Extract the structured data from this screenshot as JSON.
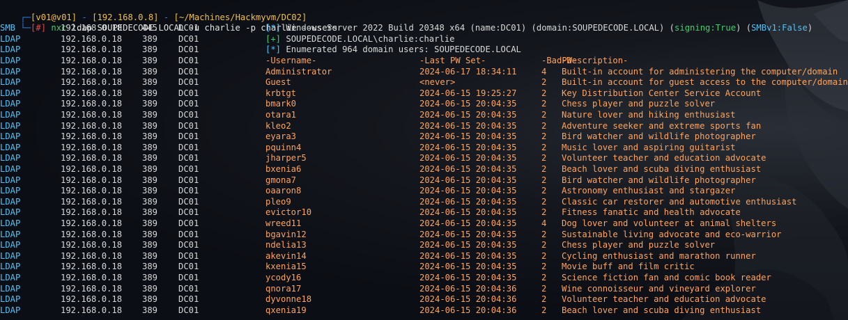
{
  "prompt": {
    "frame_top": "┌─",
    "user_host": "[v01@v01]",
    "sep1": " - ",
    "ip": "[192.168.0.8]",
    "sep2": " - ",
    "path": "[~/Machines/Hackmyvm/DC02]",
    "frame_bottom": "└─",
    "hash": "[#]",
    "command": "nxc",
    "args": " ldap SOUPEDECODE.LOCAL -u charlie -p charlie --users"
  },
  "info_lines": [
    {
      "proto": "SMB",
      "ip": "192.168.0.18",
      "port": "445",
      "host": "DC01",
      "tag": "[*]",
      "text": " Windows Server 2022 Build 20348 x64 (name:DC01) (domain:SOUPEDECODE.LOCAL) (",
      "sign_label": "signing:",
      "sign_value": "True",
      "mid": ") (",
      "smb_label": "SMBv1:",
      "smb_value": "False",
      "end": ")"
    },
    {
      "proto": "LDAP",
      "ip": "192.168.0.18",
      "port": "389",
      "host": "DC01",
      "tag": "[+]",
      "text": " SOUPEDECODE.LOCAL\\charlie:charlie"
    },
    {
      "proto": "LDAP",
      "ip": "192.168.0.18",
      "port": "389",
      "host": "DC01",
      "tag": "[*]",
      "text": " Enumerated 964 domain users: SOUPEDECODE.LOCAL"
    }
  ],
  "table_header": {
    "proto": "LDAP",
    "ip": "192.168.0.18",
    "port": "389",
    "host": "DC01",
    "username": "-Username-",
    "last_pw": "-Last PW Set-",
    "badpw": "-BadPW-",
    "description": "-Description-"
  },
  "users": [
    {
      "proto": "LDAP",
      "ip": "192.168.0.18",
      "port": "389",
      "host": "DC01",
      "username": "Administrator",
      "last_pw": "2024-06-17 18:34:11",
      "badpw": "4",
      "description": "Built-in account for administering the computer/domain"
    },
    {
      "proto": "LDAP",
      "ip": "192.168.0.18",
      "port": "389",
      "host": "DC01",
      "username": "Guest",
      "last_pw": "<never>",
      "badpw": "2",
      "description": "Built-in account for guest access to the computer/domain"
    },
    {
      "proto": "LDAP",
      "ip": "192.168.0.18",
      "port": "389",
      "host": "DC01",
      "username": "krbtgt",
      "last_pw": "2024-06-15 19:25:27",
      "badpw": "2",
      "description": "Key Distribution Center Service Account"
    },
    {
      "proto": "LDAP",
      "ip": "192.168.0.18",
      "port": "389",
      "host": "DC01",
      "username": "bmark0",
      "last_pw": "2024-06-15 20:04:35",
      "badpw": "2",
      "description": "Chess player and puzzle solver"
    },
    {
      "proto": "LDAP",
      "ip": "192.168.0.18",
      "port": "389",
      "host": "DC01",
      "username": "otara1",
      "last_pw": "2024-06-15 20:04:35",
      "badpw": "2",
      "description": "Nature lover and hiking enthusiast"
    },
    {
      "proto": "LDAP",
      "ip": "192.168.0.18",
      "port": "389",
      "host": "DC01",
      "username": "kleo2",
      "last_pw": "2024-06-15 20:04:35",
      "badpw": "2",
      "description": "Adventure seeker and extreme sports fan"
    },
    {
      "proto": "LDAP",
      "ip": "192.168.0.18",
      "port": "389",
      "host": "DC01",
      "username": "eyara3",
      "last_pw": "2024-06-15 20:04:35",
      "badpw": "2",
      "description": "Bird watcher and wildlife photographer"
    },
    {
      "proto": "LDAP",
      "ip": "192.168.0.18",
      "port": "389",
      "host": "DC01",
      "username": "pquinn4",
      "last_pw": "2024-06-15 20:04:35",
      "badpw": "2",
      "description": "Music lover and aspiring guitarist"
    },
    {
      "proto": "LDAP",
      "ip": "192.168.0.18",
      "port": "389",
      "host": "DC01",
      "username": "jharper5",
      "last_pw": "2024-06-15 20:04:35",
      "badpw": "2",
      "description": "Volunteer teacher and education advocate"
    },
    {
      "proto": "LDAP",
      "ip": "192.168.0.18",
      "port": "389",
      "host": "DC01",
      "username": "bxenia6",
      "last_pw": "2024-06-15 20:04:35",
      "badpw": "2",
      "description": "Beach lover and scuba diving enthusiast"
    },
    {
      "proto": "LDAP",
      "ip": "192.168.0.18",
      "port": "389",
      "host": "DC01",
      "username": "gmona7",
      "last_pw": "2024-06-15 20:04:35",
      "badpw": "2",
      "description": "Bird watcher and wildlife photographer"
    },
    {
      "proto": "LDAP",
      "ip": "192.168.0.18",
      "port": "389",
      "host": "DC01",
      "username": "oaaron8",
      "last_pw": "2024-06-15 20:04:35",
      "badpw": "2",
      "description": "Astronomy enthusiast and stargazer"
    },
    {
      "proto": "LDAP",
      "ip": "192.168.0.18",
      "port": "389",
      "host": "DC01",
      "username": "pleo9",
      "last_pw": "2024-06-15 20:04:35",
      "badpw": "2",
      "description": "Classic car restorer and automotive enthusiast"
    },
    {
      "proto": "LDAP",
      "ip": "192.168.0.18",
      "port": "389",
      "host": "DC01",
      "username": "evictor10",
      "last_pw": "2024-06-15 20:04:35",
      "badpw": "2",
      "description": "Fitness fanatic and health advocate"
    },
    {
      "proto": "LDAP",
      "ip": "192.168.0.18",
      "port": "389",
      "host": "DC01",
      "username": "wreed11",
      "last_pw": "2024-06-15 20:04:35",
      "badpw": "4",
      "description": "Dog lover and volunteer at animal shelters"
    },
    {
      "proto": "LDAP",
      "ip": "192.168.0.18",
      "port": "389",
      "host": "DC01",
      "username": "bgavin12",
      "last_pw": "2024-06-15 20:04:35",
      "badpw": "2",
      "description": "Sustainable living advocate and eco-warrior"
    },
    {
      "proto": "LDAP",
      "ip": "192.168.0.18",
      "port": "389",
      "host": "DC01",
      "username": "ndelia13",
      "last_pw": "2024-06-15 20:04:35",
      "badpw": "2",
      "description": "Chess player and puzzle solver"
    },
    {
      "proto": "LDAP",
      "ip": "192.168.0.18",
      "port": "389",
      "host": "DC01",
      "username": "akevin14",
      "last_pw": "2024-06-15 20:04:35",
      "badpw": "2",
      "description": "Cycling enthusiast and marathon runner"
    },
    {
      "proto": "LDAP",
      "ip": "192.168.0.18",
      "port": "389",
      "host": "DC01",
      "username": "kxenia15",
      "last_pw": "2024-06-15 20:04:35",
      "badpw": "2",
      "description": "Movie buff and film critic"
    },
    {
      "proto": "LDAP",
      "ip": "192.168.0.18",
      "port": "389",
      "host": "DC01",
      "username": "ycody16",
      "last_pw": "2024-06-15 20:04:35",
      "badpw": "2",
      "description": "Science fiction fan and comic book reader"
    },
    {
      "proto": "LDAP",
      "ip": "192.168.0.18",
      "port": "389",
      "host": "DC01",
      "username": "qnora17",
      "last_pw": "2024-06-15 20:04:36",
      "badpw": "2",
      "description": "Wine connoisseur and vineyard explorer"
    },
    {
      "proto": "LDAP",
      "ip": "192.168.0.18",
      "port": "389",
      "host": "DC01",
      "username": "dyvonne18",
      "last_pw": "2024-06-15 20:04:36",
      "badpw": "2",
      "description": "Volunteer teacher and education advocate"
    },
    {
      "proto": "LDAP",
      "ip": "192.168.0.18",
      "port": "389",
      "host": "DC01",
      "username": "qxenia19",
      "last_pw": "2024-06-15 20:04:36",
      "badpw": "2",
      "description": "Beach lover and scuba diving enthusiast"
    }
  ],
  "colors": {
    "background": "#0b0e14",
    "protocol": "#4fc3f7",
    "table_text": "#ffa45c",
    "success_tag": "#3fd16b",
    "info_tag": "#4fc3f7",
    "prompt_frame": "#2f7fe0",
    "prompt_text": "#f0c04a",
    "prompt_hash": "#e14c4c"
  }
}
